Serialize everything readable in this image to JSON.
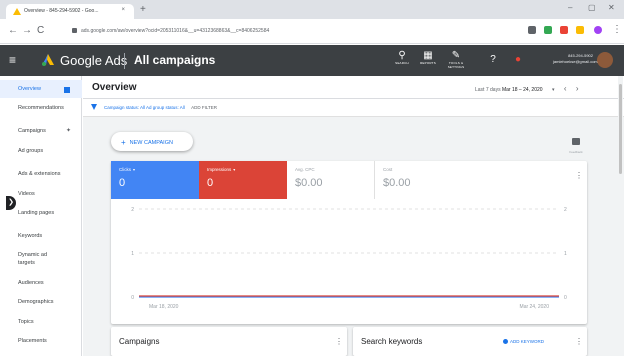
{
  "browser": {
    "tab_title": "Overview - 845-294-5902 - Goo...",
    "tab_close": "×",
    "new_tab": "+",
    "win_min": "–",
    "win_max": "▢",
    "win_close": "✕",
    "back": "←",
    "forward": "→",
    "reload": "C",
    "url": "ads.google.com/aw/overview?ocid=205311016&__u=4312368863&__c=8406252584",
    "ext_colors": [
      "#5f6368",
      "#34a853",
      "#ea4335",
      "#fbbc04",
      "#a142f4"
    ]
  },
  "ads_header": {
    "menu_icon": "≡",
    "product": "Google Ads",
    "section": "All campaigns",
    "tools": [
      {
        "label": "SEARCH",
        "glyph": "⚲"
      },
      {
        "label": "REPORTS",
        "glyph": "▦"
      },
      {
        "label": "TOOLS & SETTINGS",
        "glyph": "✎"
      }
    ],
    "help_glyph": "?",
    "bell_glyph": "●",
    "account_phone": "845-294-5902",
    "account_email": "jamiehoekse@gmail.com"
  },
  "sidebar": {
    "items": [
      {
        "label": "Overview"
      },
      {
        "label": "Recommendations"
      },
      {
        "label": "Campaigns"
      },
      {
        "label": "Ad groups"
      },
      {
        "label": "Ads & extensions"
      },
      {
        "label": "Videos"
      },
      {
        "label": "Landing pages"
      },
      {
        "label": "Keywords"
      },
      {
        "label": "Dynamic ad targets"
      },
      {
        "label": "Audiences"
      },
      {
        "label": "Demographics"
      },
      {
        "label": "Topics"
      },
      {
        "label": "Placements"
      }
    ],
    "handle_glyph": "❯",
    "pin_glyph": "✦"
  },
  "overview": {
    "title": "Overview",
    "date_prefix": "Last 7 days",
    "date_range": "Mar 18 – 24, 2020",
    "date_caret": "▾",
    "prev": "‹",
    "next": "›"
  },
  "filters": {
    "text": "Campaign status: All   Ad group status: All",
    "add": "ADD FILTER"
  },
  "new_campaign": {
    "plus": "+",
    "label": "NEW CAMPAIGN"
  },
  "feedback": {
    "label": "Feedback"
  },
  "metrics": {
    "clicks": {
      "label": "Clicks",
      "value": "0",
      "caret": "▾"
    },
    "impressions": {
      "label": "Impressions",
      "value": "0",
      "caret": "▾"
    },
    "avg_cpc": {
      "label": "Avg. CPC",
      "value": "$0.00"
    },
    "cost": {
      "label": "Cost",
      "value": "$0.00"
    },
    "menu": "⋮"
  },
  "chart_data": {
    "type": "line",
    "x": [
      "Mar 18, 2020",
      "Mar 24, 2020"
    ],
    "y_ticks_left": [
      "2",
      "1",
      "0"
    ],
    "y_ticks_right": [
      "2",
      "1",
      "0"
    ],
    "series": [
      {
        "name": "Clicks",
        "values": [
          0,
          0
        ],
        "color": "#4285f4"
      },
      {
        "name": "Impressions",
        "values": [
          0,
          0
        ],
        "color": "#db4437"
      }
    ],
    "ylim": [
      0,
      2
    ],
    "grid": true
  },
  "panels": {
    "campaigns": {
      "title": "Campaigns",
      "menu": "⋮"
    },
    "keywords": {
      "title": "Search keywords",
      "add": "ADD KEYWORD",
      "menu": "⋮"
    }
  },
  "colors": {
    "accent": "#1a73e8",
    "clicks": "#4285f4",
    "impressions": "#db4437",
    "header": "#3c4043"
  }
}
